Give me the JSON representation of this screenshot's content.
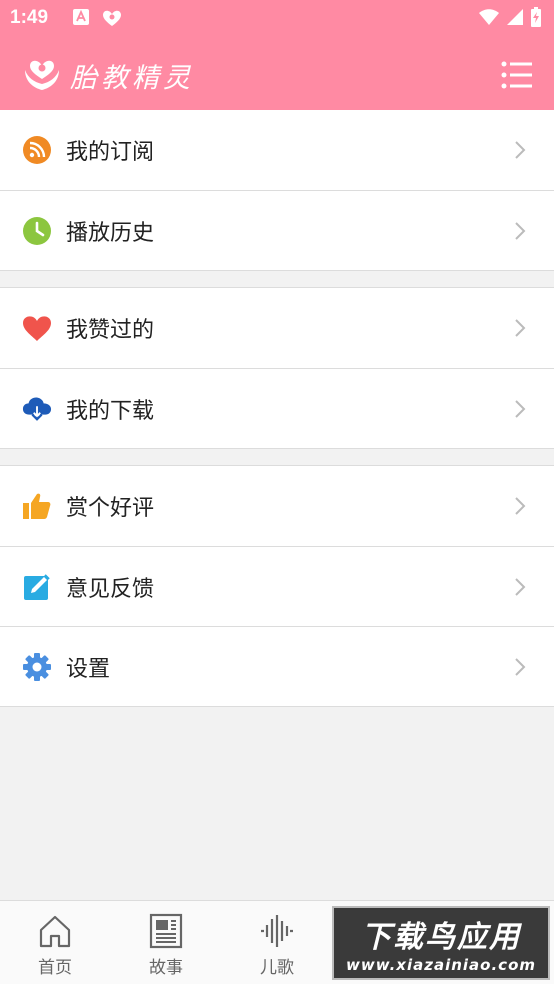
{
  "status_bar": {
    "time": "1:49"
  },
  "app_bar": {
    "title": "胎教精灵"
  },
  "colors": {
    "header": "#ff8aa3",
    "rss": "#f08a24",
    "history": "#8cc63f",
    "heart": "#f0544c",
    "download": "#1e5bb8",
    "thumb": "#f5a623",
    "edit": "#29abe2",
    "settings": "#4a8fe0"
  },
  "groups": [
    {
      "items": [
        {
          "label": "我的订阅",
          "icon": "rss-icon"
        },
        {
          "label": "播放历史",
          "icon": "clock-icon"
        }
      ]
    },
    {
      "items": [
        {
          "label": "我赞过的",
          "icon": "heart-icon"
        },
        {
          "label": "我的下载",
          "icon": "cloud-download-icon"
        }
      ]
    },
    {
      "items": [
        {
          "label": "赏个好评",
          "icon": "thumbs-up-icon"
        },
        {
          "label": "意见反馈",
          "icon": "edit-icon"
        },
        {
          "label": "设置",
          "icon": "gear-icon"
        }
      ]
    }
  ],
  "tabs": [
    {
      "label": "首页",
      "icon": "home-icon"
    },
    {
      "label": "故事",
      "icon": "newspaper-icon"
    },
    {
      "label": "儿歌",
      "icon": "audio-wave-icon"
    }
  ],
  "watermark": {
    "title": "下载鸟应用",
    "url": "www.xiazainiao.com"
  }
}
